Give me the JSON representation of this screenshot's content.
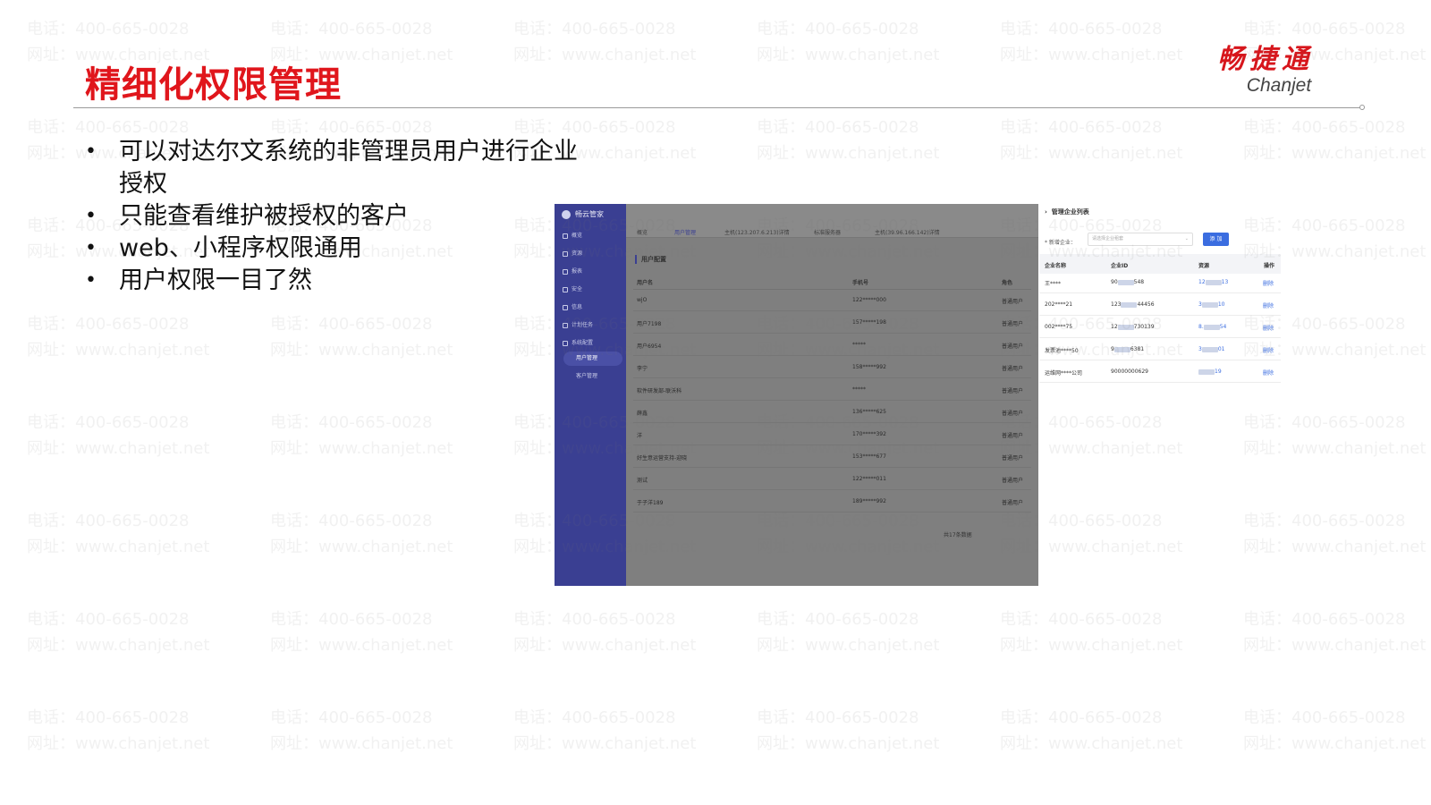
{
  "slide": {
    "title": "精细化权限管理",
    "bullets": [
      "可以对达尔文系统的非管理员用户进行企业授权",
      "只能查看维护被授权的客户",
      "web、小程序权限通用",
      "用户权限一目了然"
    ]
  },
  "logo": {
    "cn": "畅捷通",
    "en": "Chanjet"
  },
  "watermark": {
    "phone": "电话：400-665-0028",
    "site": "网址：www.chanjet.net"
  },
  "user_config_screen": {
    "brand": "畅云管家",
    "sidebar": [
      "概览",
      "资源",
      "报表",
      "安全",
      "信息",
      "计划任务",
      "系统配置"
    ],
    "sidebar_sub": [
      "用户管理",
      "客户管理"
    ],
    "tabs": [
      "概览",
      "用户管理",
      "主机(123.207.6.213)详情",
      "标准服务器",
      "主机(39.96.166.142)详情"
    ],
    "section_title": "用户配置",
    "columns": [
      "用户名",
      "手机号",
      "角色"
    ],
    "rows": [
      [
        "wjO",
        "122*****000",
        "普通用户"
      ],
      [
        "用户7198",
        "157*****198",
        "普通用户"
      ],
      [
        "用户6954",
        "*****",
        "普通用户"
      ],
      [
        "李宁",
        "158*****992",
        "普通用户"
      ],
      [
        "软件研发部-联沃科",
        "*****",
        "普通用户"
      ],
      [
        "薛鑫",
        "136*****625",
        "普通用户"
      ],
      [
        "洋",
        "170*****392",
        "普通用户"
      ],
      [
        "好生意运营支持-迎晓",
        "153*****677",
        "普通用户"
      ],
      [
        "测试",
        "122*****011",
        "普通用户"
      ],
      [
        "于子洋189",
        "189*****992",
        "普通用户"
      ]
    ],
    "footer": "共17条数据"
  },
  "company_list_screen": {
    "title": "管理企业列表",
    "add_label": "* 新增企业：",
    "select_placeholder": "请选择企业租套",
    "add_button": "添 加",
    "columns": [
      "企业名称",
      "企业ID",
      "资源",
      "操作"
    ],
    "rows": [
      {
        "name": "王****",
        "id": "90",
        "id_tail": "548",
        "res": "12",
        "res_tail": "13"
      },
      {
        "name": "202****21",
        "id": "123",
        "id_tail": "44456",
        "res": "3",
        "res_tail": "10"
      },
      {
        "name": "002****75",
        "id": "12",
        "id_tail": "730139",
        "res": "8.",
        "res_tail": "54"
      },
      {
        "name": "发票池****50",
        "id": "9",
        "id_tail": "6381",
        "res": "3",
        "res_tail": "01"
      },
      {
        "name": "运维网****公司",
        "id": "90000000629",
        "id_tail": "",
        "res": "",
        "res_tail": "19"
      }
    ],
    "action": "删除"
  }
}
